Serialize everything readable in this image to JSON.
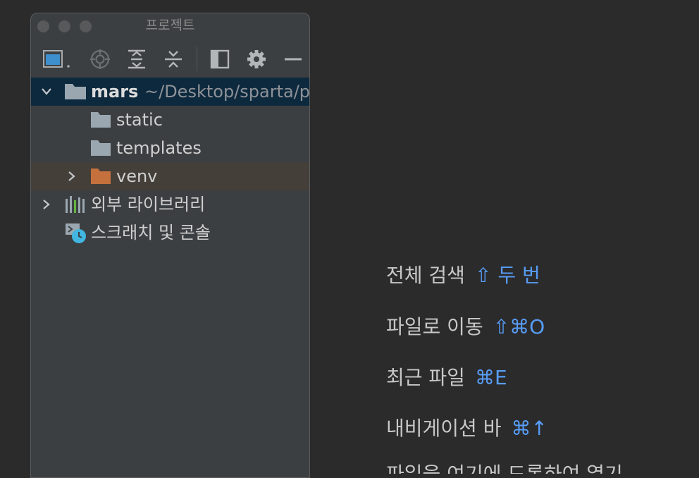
{
  "window": {
    "title": "프로젝트"
  },
  "toolbar": {
    "items": [
      {
        "icon": "project-view-icon"
      },
      {
        "icon": "locate-target-icon"
      },
      {
        "icon": "expand-all-icon"
      },
      {
        "icon": "collapse-all-icon"
      },
      {
        "icon": "panel-layout-icon"
      },
      {
        "icon": "gear-icon"
      },
      {
        "icon": "minimize-icon"
      }
    ]
  },
  "tree": {
    "root": {
      "name": "mars",
      "path": "~/Desktop/sparta/projects/mars"
    },
    "children": [
      {
        "name": "static"
      },
      {
        "name": "templates"
      },
      {
        "name": "venv"
      }
    ],
    "external_libraries": "외부 라이브러리",
    "scratches": "스크래치 및 콘솔"
  },
  "hints": [
    {
      "text": "전체 검색",
      "keys": "⇧ 두 번"
    },
    {
      "text": "파일로 이동",
      "keys": "⇧⌘O"
    },
    {
      "text": "최근 파일",
      "keys": "⌘E"
    },
    {
      "text": "내비게이션 바",
      "keys": "⌘↑"
    },
    {
      "text": "파일을 여기에 드롭하여 열기",
      "keys": ""
    }
  ],
  "colors": {
    "editor_bg": "#2b2b2c",
    "panel_bg": "#3c3f41",
    "selection": "#0d293e",
    "venv_highlight": "#443f39",
    "shortcut_accent": "#589df6",
    "folder": "#9aa7b0",
    "venv_folder": "#c5713d"
  }
}
